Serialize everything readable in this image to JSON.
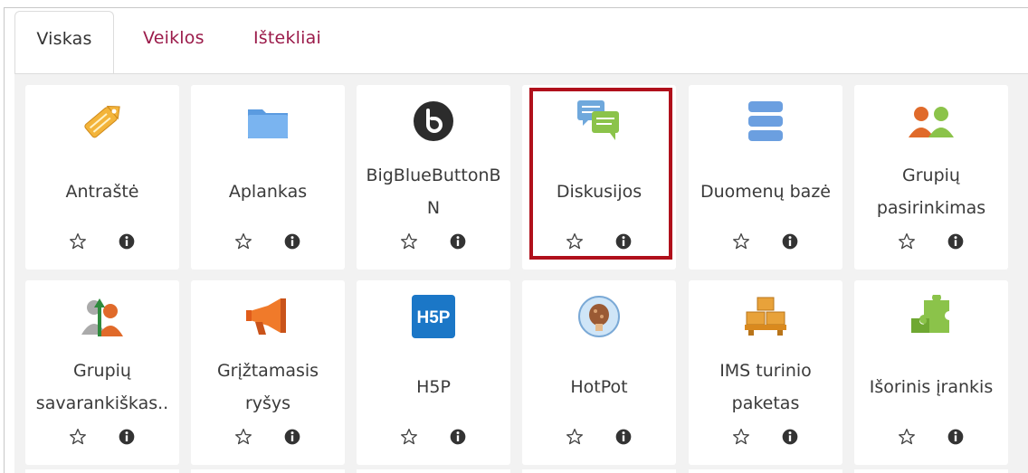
{
  "tabs": [
    {
      "label": "Viskas",
      "active": true
    },
    {
      "label": "Veiklos",
      "active": false
    },
    {
      "label": "Ištekliai",
      "active": false
    }
  ],
  "modules": [
    {
      "label": "Antraštė",
      "icon": "label-tag-icon"
    },
    {
      "label": "Aplankas",
      "icon": "folder-icon"
    },
    {
      "label": "BigBlueButtonB\nN",
      "icon": "bigbluebutton-icon"
    },
    {
      "label": "Diskusijos",
      "icon": "forum-icon",
      "highlighted": true
    },
    {
      "label": "Duomenų bazė",
      "icon": "database-icon"
    },
    {
      "label": "Grupių\npasirinkimas",
      "icon": "group-choice-icon"
    },
    {
      "label": "Grupių\nsavarankiškas..",
      "icon": "group-self-selection-icon"
    },
    {
      "label": "Grįžtamasis\nryšys",
      "icon": "feedback-megaphone-icon"
    },
    {
      "label": "H5P",
      "icon": "h5p-icon"
    },
    {
      "label": "HotPot",
      "icon": "hotpot-icon"
    },
    {
      "label": "IMS turinio\npaketas",
      "icon": "ims-package-icon"
    },
    {
      "label": "Išorinis įrankis",
      "icon": "external-tool-puzzle-icon"
    }
  ],
  "colors": {
    "tab_link": "#9b1b4a",
    "highlight_border": "#b0101b",
    "background": "#f2f2f2"
  },
  "action_icons": [
    "star-outline-icon",
    "info-icon"
  ]
}
